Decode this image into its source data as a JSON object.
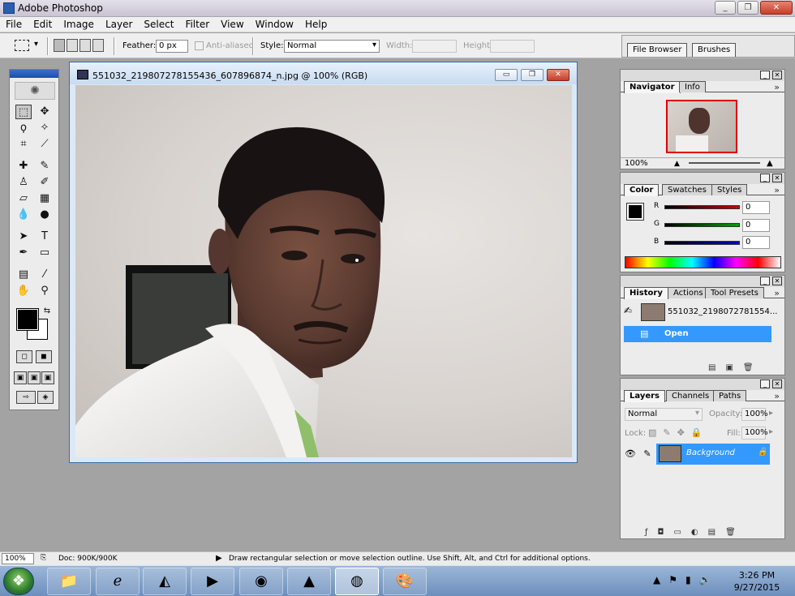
{
  "window": {
    "title": "Adobe Photoshop",
    "min": "_",
    "restore": "❐",
    "close": "✕"
  },
  "menu": [
    "File",
    "Edit",
    "Image",
    "Layer",
    "Select",
    "Filter",
    "View",
    "Window",
    "Help"
  ],
  "options": {
    "feather_label": "Feather:",
    "feather_value": "0 px",
    "antialias_label": "Anti-aliased",
    "style_label": "Style:",
    "style_value": "Normal",
    "width_label": "Width:",
    "height_label": "Height:"
  },
  "palette_well": {
    "tabs": [
      "File Browser",
      "Brushes"
    ]
  },
  "document": {
    "title": "551032_219807278155436_607896874_n.jpg @ 100% (RGB)",
    "min": "▭",
    "restore": "❐",
    "close": "✕"
  },
  "navigator": {
    "tabs": [
      "Navigator",
      "Info"
    ],
    "zoom": "100%"
  },
  "color": {
    "tabs": [
      "Color",
      "Swatches",
      "Styles"
    ],
    "channels": [
      {
        "label": "R",
        "value": "0",
        "color": "#cc0000"
      },
      {
        "label": "G",
        "value": "0",
        "color": "#00a000"
      },
      {
        "label": "B",
        "value": "0",
        "color": "#0000cc"
      }
    ]
  },
  "history": {
    "tabs": [
      "History",
      "Actions",
      "Tool Presets"
    ],
    "snapshot": "551032_2198072781554...",
    "items": [
      "Open"
    ]
  },
  "layers": {
    "tabs": [
      "Layers",
      "Channels",
      "Paths"
    ],
    "blend": "Normal",
    "opacity_label": "Opacity:",
    "opacity": "100%",
    "lock_label": "Lock:",
    "fill_label": "Fill:",
    "fill": "100%",
    "layer_name": "Background"
  },
  "status": {
    "zoom": "100%",
    "doc": "Doc: 900K/900K",
    "hint": "Draw rectangular selection or move selection outline.  Use Shift, Alt, and Ctrl for additional options."
  },
  "taskbar": {
    "time": "3:26 PM",
    "date": "9/27/2015"
  },
  "colors": {
    "accent": "#3399ff",
    "toolbox_header": "#1f4ea8",
    "foreground": "#000000",
    "background": "#ffffff"
  }
}
